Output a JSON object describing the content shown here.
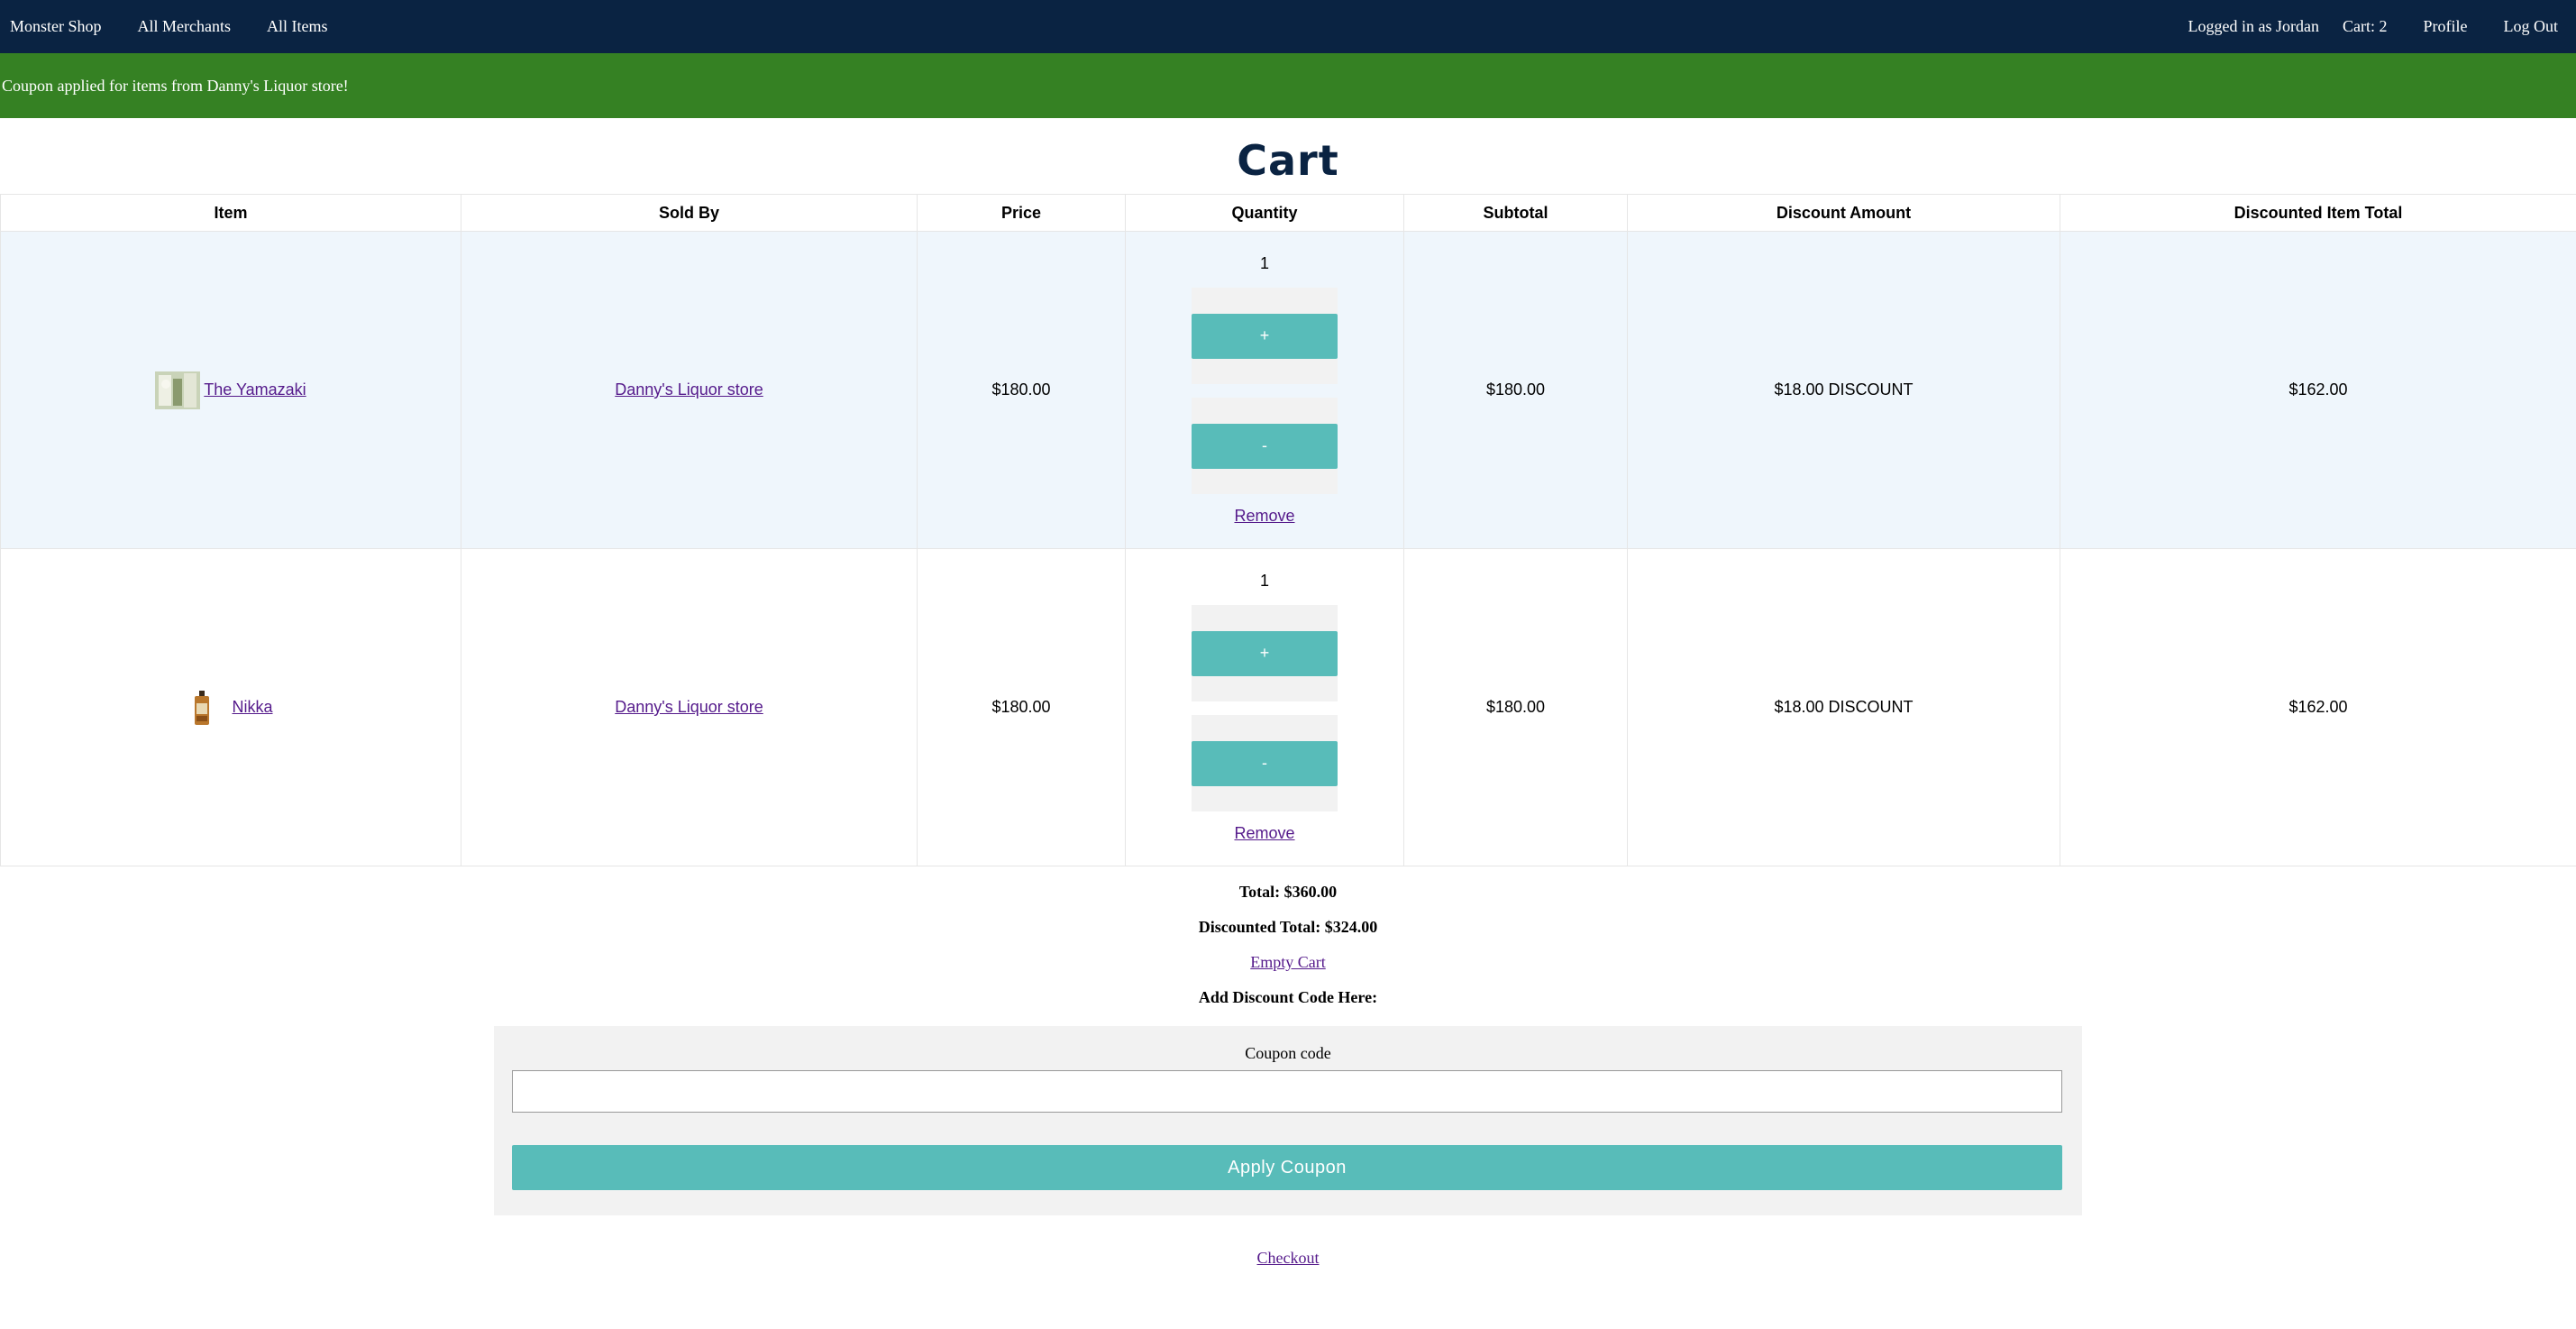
{
  "nav": {
    "brand": "Monster Shop",
    "merchants": "All Merchants",
    "items": "All Items",
    "user": "Logged in as Jordan",
    "cart": "Cart: 2",
    "profile": "Profile",
    "logout": "Log Out"
  },
  "flash": "Coupon applied for items from Danny's Liquor store!",
  "title": "Cart",
  "table": {
    "headers": [
      "Item",
      "Sold By",
      "Price",
      "Quantity",
      "Subtotal",
      "Discount Amount",
      "Discounted Item Total"
    ],
    "rows": [
      {
        "name": "The Yamazaki",
        "icon": "yamazaki-thumbnail-icon",
        "seller": "Danny's Liquor store",
        "price": "$180.00",
        "quantity": "1",
        "plus": "+",
        "minus": "-",
        "remove": "Remove",
        "subtotal": "$180.00",
        "discount": "$18.00 DISCOUNT",
        "discounted_total": "$162.00"
      },
      {
        "name": "Nikka",
        "icon": "nikka-bottle-icon",
        "seller": "Danny's Liquor store",
        "price": "$180.00",
        "quantity": "1",
        "plus": "+",
        "minus": "-",
        "remove": "Remove",
        "subtotal": "$180.00",
        "discount": "$18.00 DISCOUNT",
        "discounted_total": "$162.00"
      }
    ]
  },
  "summary": {
    "total": "Total: $360.00",
    "discounted_total": "Discounted Total: $324.00",
    "empty_cart": "Empty Cart",
    "add_code": "Add Discount Code Here:"
  },
  "coupon": {
    "label": "Coupon code",
    "value": "",
    "button": "Apply Coupon"
  },
  "checkout": "Checkout",
  "colors": {
    "nav_bg": "#0a2342",
    "flash_bg": "#358123",
    "button": "#58bcb9",
    "row_alt": "#eff6fc",
    "link": "#551a8b"
  }
}
